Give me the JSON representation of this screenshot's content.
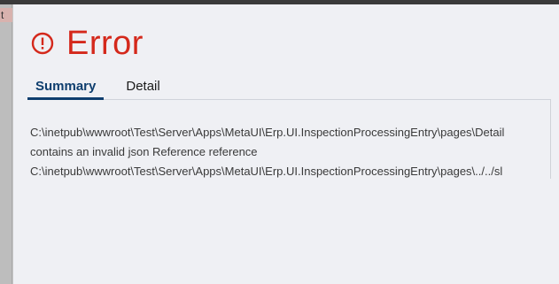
{
  "sidebar_fragment": {
    "text": "t"
  },
  "error": {
    "title": "Error",
    "icon": "exclamation-circle-icon",
    "color": "#d4281b"
  },
  "tabs": [
    {
      "label": "Summary",
      "active": true
    },
    {
      "label": "Detail",
      "active": false
    }
  ],
  "message": {
    "lines": [
      "C:\\inetpub\\wwwroot\\Test\\Server\\Apps\\MetaUI\\Erp.UI.InspectionProcessingEntry\\pages\\Detail",
      "contains an invalid json Reference reference",
      "C:\\inetpub\\wwwroot\\Test\\Server\\Apps\\MetaUI\\Erp.UI.InspectionProcessingEntry\\pages\\../../sl"
    ]
  },
  "colors": {
    "tab_active": "#0e3e6e",
    "panel_bg": "#eff0f4"
  }
}
